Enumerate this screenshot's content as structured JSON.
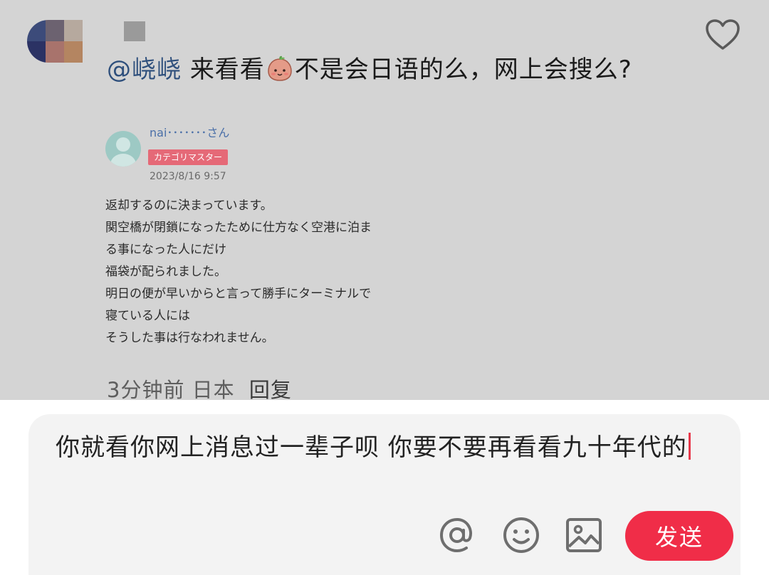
{
  "comment": {
    "mention": "@峣峣",
    "text_before_emoji": "来看看",
    "emoji": "potato-face-emoji",
    "text_after_emoji": "不是会日语的么，网上会搜么?",
    "meta": {
      "time": "3分钟前",
      "location": "日本",
      "reply_label": "回复"
    }
  },
  "embedded_post": {
    "name": "nai･･･････さん",
    "badge": "カテゴリマスター",
    "date": "2023/8/16 9:57",
    "lines": [
      "返却するのに決まっています。",
      "関空橋が閉鎖になったために仕方なく空港に泊ま",
      "る事になった人にだけ",
      "福袋が配られました。",
      "明日の便が早いからと言って勝手にターミナルで",
      "寝ている人には",
      "そうした事は行なわれません。"
    ]
  },
  "input": {
    "value": "你就看你网上消息过一辈子呗 你要不要再看看九十年代的"
  },
  "toolbar": {
    "mention_icon": "at-icon",
    "emoji_icon": "smile-icon",
    "image_icon": "image-icon",
    "send_label": "发送"
  },
  "colors": {
    "accent": "#f02d48",
    "mention": "#2e4f7c",
    "overlay": "#d4d4d4"
  }
}
